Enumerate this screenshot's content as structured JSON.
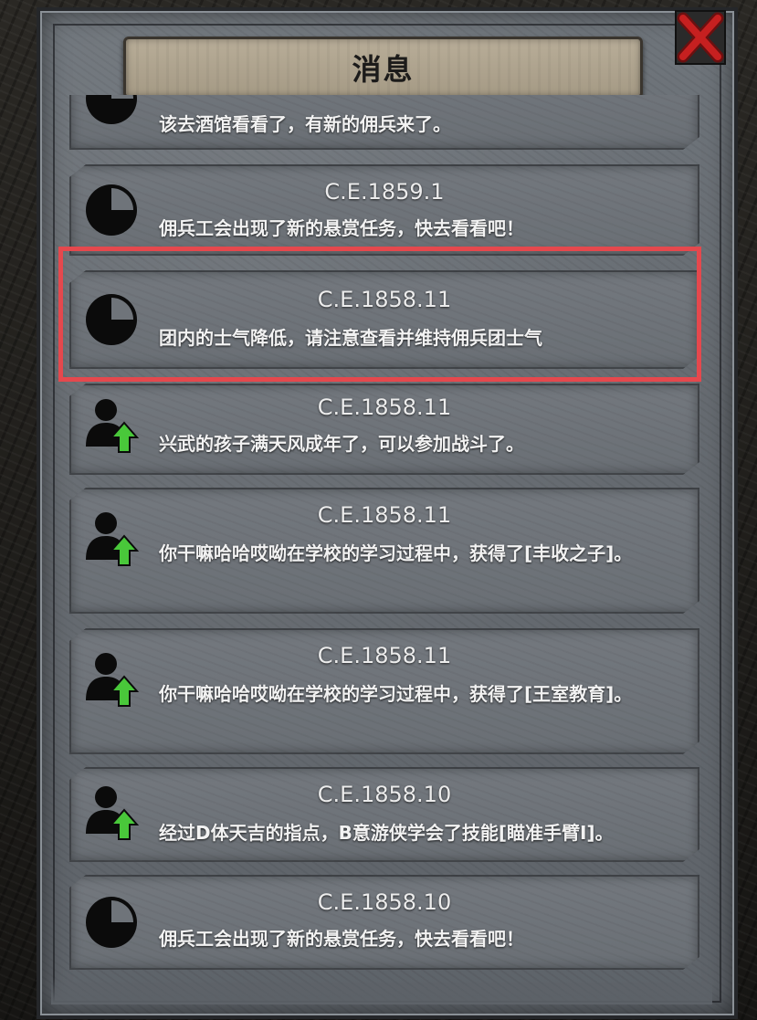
{
  "dialog": {
    "title": "消息",
    "close_icon": "close-x-icon",
    "accent_color": "#e5484d"
  },
  "messages": [
    {
      "date": "",
      "text": "该去酒馆看看了，有新的佣兵来了。",
      "icon": "pie-clock-icon"
    },
    {
      "date": "C.E.1859.1",
      "text": "佣兵工会出现了新的悬赏任务，快去看看吧！",
      "icon": "pie-clock-icon"
    },
    {
      "date": "C.E.1858.11",
      "text": "团内的士气降低，请注意查看并维持佣兵团士气",
      "icon": "pie-clock-icon"
    },
    {
      "date": "C.E.1858.11",
      "text": "兴武的孩子满天风成年了，可以参加战斗了。",
      "icon": "person-up-arrow-icon"
    },
    {
      "date": "C.E.1858.11",
      "text": "你干嘛哈哈哎呦在学校的学习过程中，获得了[丰收之子]。",
      "icon": "person-up-arrow-icon"
    },
    {
      "date": "C.E.1858.11",
      "text": "你干嘛哈哈哎呦在学校的学习过程中，获得了[王室教育]。",
      "icon": "person-up-arrow-icon"
    },
    {
      "date": "C.E.1858.10",
      "text": "经过D体天吉的指点，B意游侠学会了技能[瞄准手臂I]。",
      "icon": "person-up-arrow-icon"
    },
    {
      "date": "C.E.1858.10",
      "text": "佣兵工会出现了新的悬赏任务，快去看看吧！",
      "icon": "pie-clock-icon"
    }
  ]
}
